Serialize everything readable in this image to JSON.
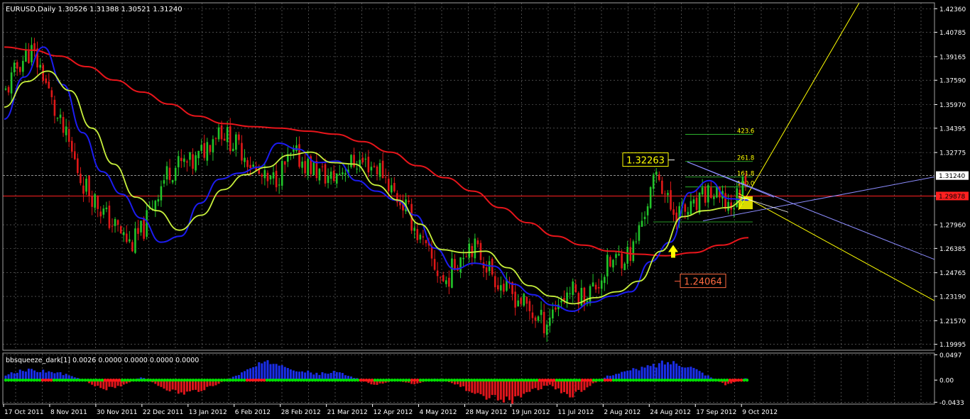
{
  "main_chart": {
    "header": "EURUSD,Daily  1.30526 1.31388 1.30521 1.31240",
    "y_ticks": [
      "1.42360",
      "1.40785",
      "1.39165",
      "1.37590",
      "1.35970",
      "1.34395",
      "1.32775",
      "1.29878",
      "1.27960",
      "1.26385",
      "1.24765",
      "1.23190",
      "1.21570",
      "1.19995"
    ],
    "y_tick_values": [
      1.4236,
      1.40785,
      1.39165,
      1.3759,
      1.3597,
      1.34395,
      1.32775,
      1.29878,
      1.2796,
      1.26385,
      1.24765,
      1.2319,
      1.2157,
      1.19995
    ],
    "current_price_label": "1.31240",
    "current_price": 1.3124,
    "red_level_label": "1.29878",
    "red_level": 1.29878,
    "label_high": "1.32263",
    "label_low": "1.24064",
    "fib_levels": [
      {
        "label": "423.6",
        "value": 1.3399
      },
      {
        "label": "261.8",
        "value": 1.3218
      },
      {
        "label": "161.8",
        "value": 1.3114
      },
      {
        "label": "100.0",
        "value": 1.3048
      }
    ],
    "ylim": [
      1.196,
      1.4275
    ],
    "background": "#000000",
    "grid_color": "#777777",
    "bull_color": "#22c42a",
    "bear_color": "#e01818",
    "ma_slow_color": "#e8151b",
    "ma_fast_color": "#1c1cf0",
    "ma_mid_color": "#c8f03c",
    "fib_color": "#ffff00",
    "fan_color": "#8c8cff"
  },
  "indicator": {
    "label": "bbsqueeze_dark[1] 0.0026 0.0000 0.0000 0.0000 0.0000",
    "y_ticks": [
      "0.0497",
      "0.00",
      "-0.0433"
    ],
    "y_tick_values": [
      0.0497,
      0.0,
      -0.0433
    ],
    "ylim": [
      -0.047,
      0.053
    ],
    "pos_color": "#1a2ee8",
    "neg_color": "#e0161c",
    "dot_on_color": "#00e000",
    "dot_off_color": "#ff1a1a"
  },
  "x_ticks": [
    "17 Oct 2011",
    "8 Nov 2011",
    "30 Nov 2011",
    "22 Dec 2011",
    "13 Jan 2012",
    "6 Feb 2012",
    "28 Feb 2012",
    "21 Mar 2012",
    "12 Apr 2012",
    "4 May 2012",
    "28 May 2012",
    "19 Jun 2012",
    "11 Jul 2012",
    "2 Aug 2012",
    "24 Aug 2012",
    "17 Sep 2012",
    "9 Oct 2012"
  ],
  "chart_data": {
    "type": "candlestick",
    "symbol": "EURUSD",
    "timeframe": "Daily",
    "x_dates": [
      "17 Oct 2011",
      "8 Nov 2011",
      "30 Nov 2011",
      "22 Dec 2011",
      "13 Jan 2012",
      "6 Feb 2012",
      "28 Feb 2012",
      "21 Mar 2012",
      "12 Apr 2012",
      "4 May 2012",
      "28 May 2012",
      "19 Jun 2012",
      "11 Jul 2012",
      "2 Aug 2012",
      "24 Aug 2012",
      "17 Sep 2012",
      "9 Oct 2012"
    ],
    "close_path": [
      1.368,
      1.386,
      1.396,
      1.38,
      1.352,
      1.334,
      1.31,
      1.298,
      1.285,
      1.276,
      1.266,
      1.277,
      1.3,
      1.316,
      1.32,
      1.32,
      1.332,
      1.345,
      1.335,
      1.328,
      1.314,
      1.306,
      1.316,
      1.326,
      1.32,
      1.314,
      1.31,
      1.318,
      1.322,
      1.32,
      1.316,
      1.3,
      1.29,
      1.27,
      1.255,
      1.24,
      1.256,
      1.268,
      1.258,
      1.245,
      1.235,
      1.23,
      1.22,
      1.214,
      1.228,
      1.236,
      1.232,
      1.238,
      1.252,
      1.258,
      1.262,
      1.29,
      1.315,
      1.29,
      1.288,
      1.29,
      1.302,
      1.295,
      1.2924,
      1.3124
    ],
    "ma_slow": [
      1.398,
      1.396,
      1.392,
      1.385,
      1.376,
      1.368,
      1.36,
      1.352,
      1.347,
      1.345,
      1.344,
      1.342,
      1.34,
      1.335,
      1.328,
      1.319,
      1.311,
      1.302,
      1.291,
      1.281,
      1.272,
      1.266,
      1.262,
      1.26,
      1.259,
      1.261,
      1.266,
      1.271
    ],
    "ma_fast": [
      1.35,
      1.378,
      1.398,
      1.373,
      1.341,
      1.315,
      1.3,
      1.284,
      1.268,
      1.272,
      1.294,
      1.31,
      1.314,
      1.318,
      1.334,
      1.33,
      1.321,
      1.322,
      1.309,
      1.302,
      1.296,
      1.286,
      1.264,
      1.25,
      1.254,
      1.252,
      1.24,
      1.233,
      1.226,
      1.222,
      1.228,
      1.232,
      1.235,
      1.255,
      1.268,
      1.301,
      1.309,
      1.297,
      1.296
    ],
    "ma_mid": [
      1.358,
      1.375,
      1.382,
      1.369,
      1.344,
      1.32,
      1.298,
      1.289,
      1.276,
      1.286,
      1.303,
      1.313,
      1.318,
      1.326,
      1.328,
      1.321,
      1.32,
      1.306,
      1.296,
      1.28,
      1.263,
      1.261,
      1.262,
      1.251,
      1.239,
      1.232,
      1.227,
      1.231,
      1.235,
      1.242,
      1.262,
      1.285,
      1.289,
      1.291,
      1.298
    ],
    "indicator_histogram_path": [
      0.01,
      0.02,
      0.018,
      0.012,
      0.0,
      -0.018,
      -0.01,
      0.006,
      -0.014,
      -0.028,
      -0.02,
      -0.006,
      0.012,
      0.03,
      0.036,
      0.02,
      0.012,
      0.016,
      0.004,
      -0.01,
      0.0,
      -0.008,
      0.003,
      -0.006,
      -0.024,
      -0.036,
      -0.04,
      -0.02,
      -0.01,
      -0.034,
      -0.01,
      0.01,
      0.018,
      0.026,
      0.036,
      0.03,
      0.01,
      -0.01,
      0.004
    ],
    "ylim": [
      1.196,
      1.4275
    ]
  }
}
